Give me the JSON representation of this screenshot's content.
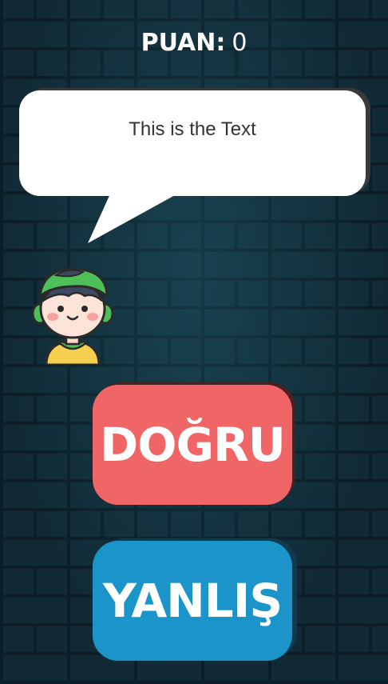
{
  "score": {
    "label": "PUAN:",
    "value": "0"
  },
  "speech_bubble": {
    "text": "This is the Text"
  },
  "buttons": {
    "correct_label": "DOĞRU",
    "wrong_label": "YANLIŞ"
  },
  "colors": {
    "background": "#112a36",
    "correct_button": "#f06666",
    "wrong_button": "#1b94c9",
    "bubble": "#ffffff"
  },
  "icons": {
    "character": "boy-with-green-cap-avatar"
  }
}
